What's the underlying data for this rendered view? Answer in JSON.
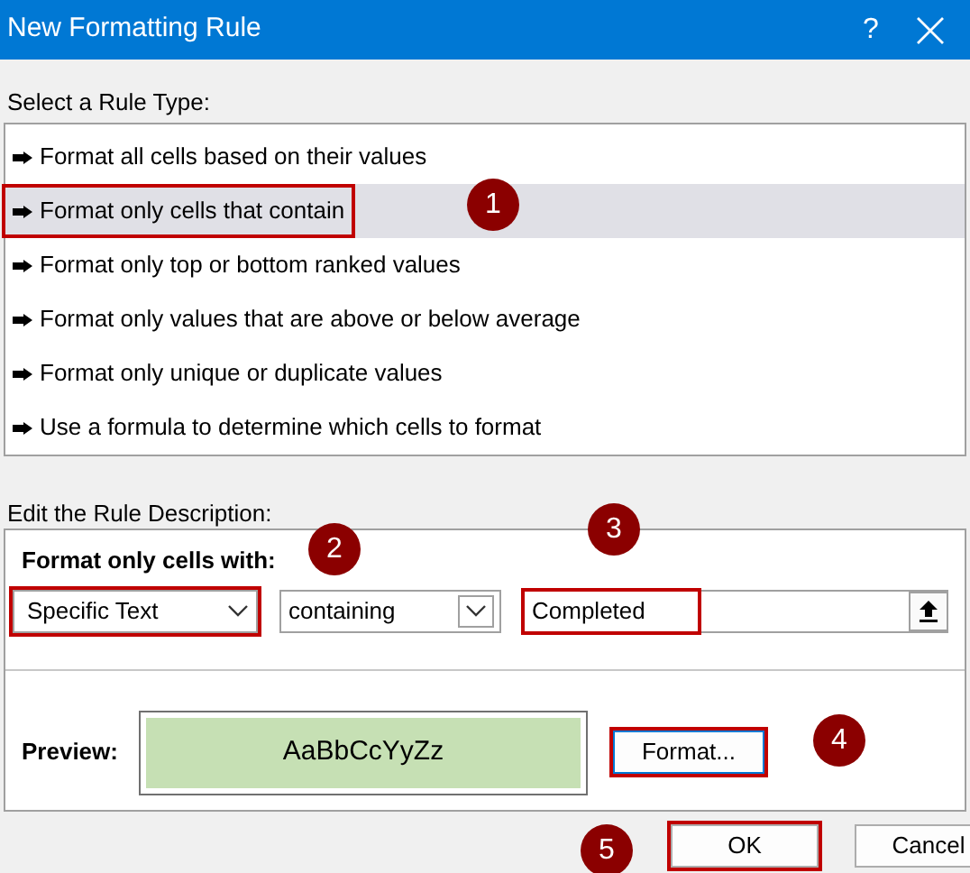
{
  "window": {
    "title": "New Formatting Rule",
    "help": "?"
  },
  "rule_type": {
    "label": "Select a Rule Type:",
    "items": [
      {
        "label": "Format all cells based on their values",
        "selected": false,
        "highlighted": false
      },
      {
        "label": "Format only cells that contain",
        "selected": true,
        "highlighted": true
      },
      {
        "label": "Format only top or bottom ranked values",
        "selected": false,
        "highlighted": false
      },
      {
        "label": "Format only values that are above or below average",
        "selected": false,
        "highlighted": false
      },
      {
        "label": "Format only unique or duplicate values",
        "selected": false,
        "highlighted": false
      },
      {
        "label": "Use a formula to determine which cells to format",
        "selected": false,
        "highlighted": false
      }
    ]
  },
  "description": {
    "label": "Edit the Rule Description:",
    "heading": "Format only cells with:",
    "condition_type": {
      "value": "Specific Text",
      "highlighted": true
    },
    "operator": {
      "value": "containing",
      "highlighted": false
    },
    "value_field": {
      "value": "Completed",
      "highlighted": true
    },
    "preview_label": "Preview:",
    "preview_text": "AaBbCcYyZz",
    "format_button": {
      "label": "Format...",
      "highlighted": true
    }
  },
  "buttons": [
    {
      "label": "OK",
      "highlighted": true
    },
    {
      "label": "Cancel",
      "highlighted": false
    }
  ],
  "callouts": [
    "1",
    "2",
    "3",
    "4",
    "5"
  ]
}
